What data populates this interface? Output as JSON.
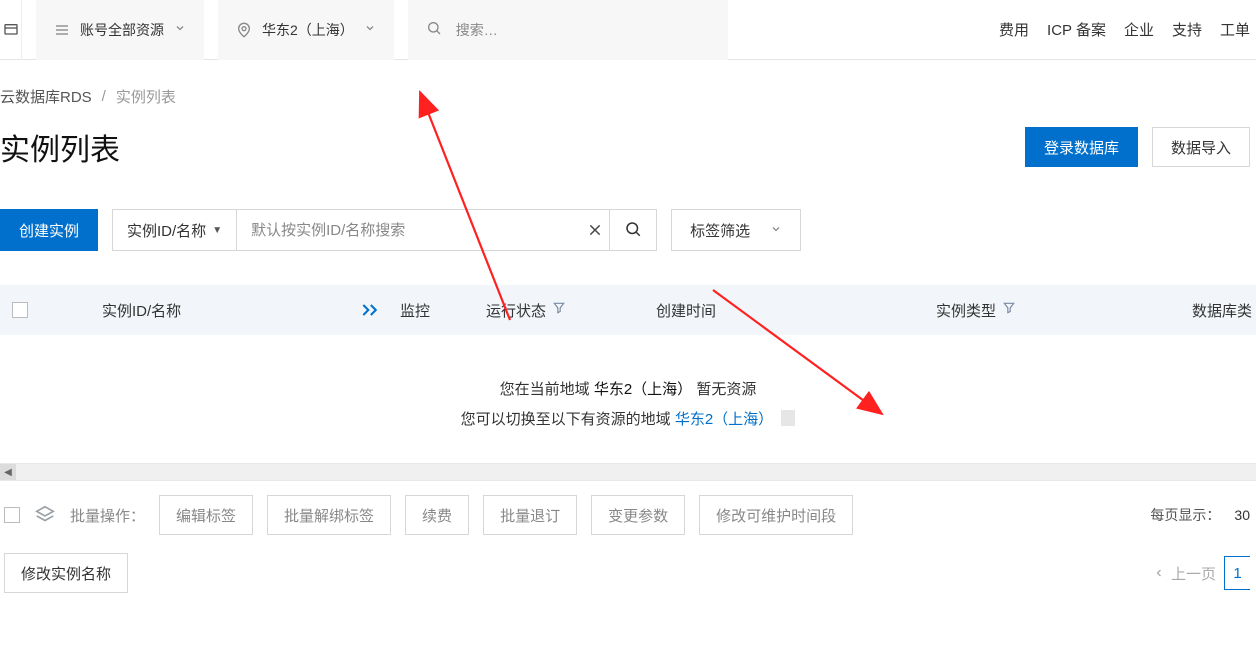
{
  "topbar": {
    "console_icon_name": "console-icon",
    "account_resources": {
      "label": "账号全部资源"
    },
    "region": {
      "label": "华东2（上海）"
    },
    "search_placeholder": "搜索…",
    "links": {
      "fees": "费用",
      "icp": "ICP 备案",
      "enterprise": "企业",
      "support": "支持",
      "tickets": "工单"
    }
  },
  "breadcrumb": {
    "root": "云数据库RDS",
    "sep": "/",
    "current": "实例列表"
  },
  "page": {
    "title": "实例列表",
    "login_db": "登录数据库",
    "import_data": "数据导入"
  },
  "toolbar": {
    "create_label": "创建实例",
    "search_type": "实例ID/名称",
    "search_placeholder": "默认按实例ID/名称搜索",
    "tag_filter": "标签筛选"
  },
  "table": {
    "columns": {
      "idname": "实例ID/名称",
      "monitor": "监控",
      "status": "运行状态",
      "created": "创建时间",
      "type": "实例类型",
      "db": "数据库类"
    }
  },
  "empty": {
    "line1_prefix": "您在当前地域 ",
    "line1_region": "华东2（上海）",
    "line1_suffix": " 暂无资源",
    "line2_prefix": "您可以切换至以下有资源的地域 ",
    "line2_link": "华东2（上海）"
  },
  "batch": {
    "label": "批量操作：",
    "buttons": {
      "edit_tags": "编辑标签",
      "unbind_tags": "批量解绑标签",
      "renew": "续费",
      "unsubscribe": "批量退订",
      "change_params": "变更参数",
      "maint_window": "修改可维护时间段",
      "rename": "修改实例名称"
    }
  },
  "pagination": {
    "per_page_label": "每页显示：",
    "per_page_value": "30",
    "prev": "上一页",
    "page_current": "1"
  }
}
